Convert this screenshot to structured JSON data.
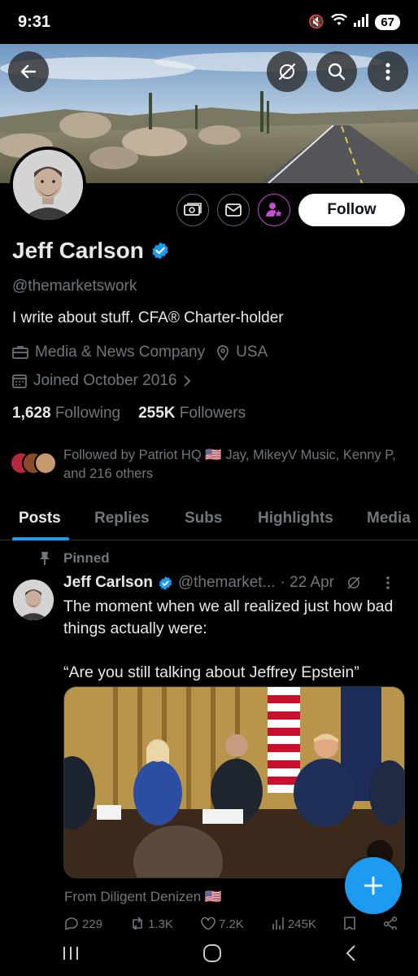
{
  "status_bar": {
    "time": "9:31",
    "battery": "67"
  },
  "profile": {
    "name": "Jeff Carlson",
    "handle": "@themarketswork",
    "bio": "I write about stuff. CFA® Charter-holder",
    "category": "Media & News Company",
    "location": "USA",
    "joined": "Joined October 2016",
    "following_count": "1,628",
    "following_label": "Following",
    "followers_count": "255K",
    "followers_label": "Followers",
    "followed_by": "Followed by Patriot HQ 🇺🇸 Jay, MikeyV Music, Kenny P, and 216 others",
    "follow_label": "Follow"
  },
  "tabs": [
    "Posts",
    "Replies",
    "Subs",
    "Highlights",
    "Media"
  ],
  "pinned_post": {
    "pinned_label": "Pinned",
    "author": "Jeff Carlson",
    "handle": "@themarket...",
    "date": "· 22 Apr",
    "text": "The moment when we all realized just how bad things actually were:\n\n“Are you still talking about Jeffrey Epstein”",
    "source": "From Diligent Denizen 🇺🇸",
    "replies": "229",
    "reposts": "1.3K",
    "likes": "7.2K",
    "views": "245K"
  },
  "colors": {
    "accent": "#1d9bf0",
    "subscribe": "#c94bd3"
  }
}
